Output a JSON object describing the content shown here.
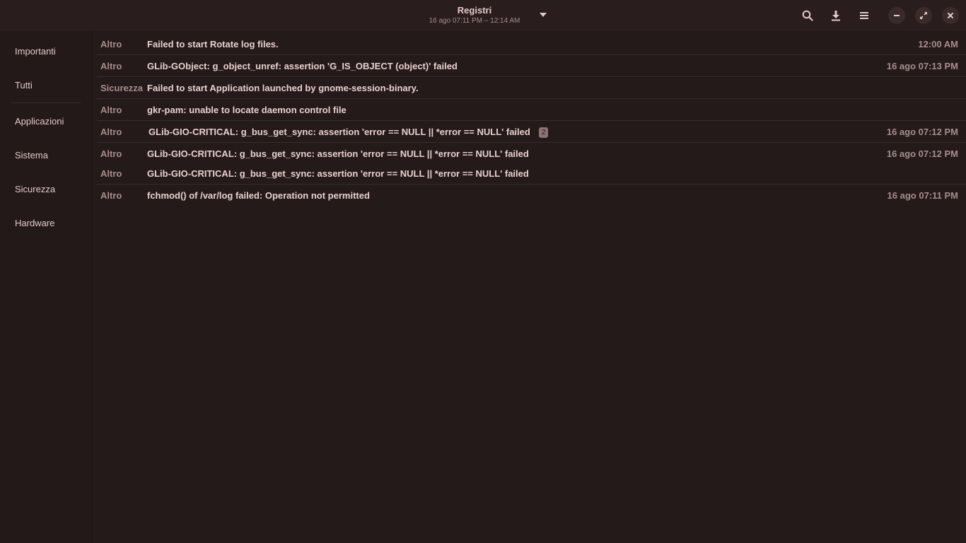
{
  "header": {
    "title": "Registri",
    "subtitle": "16 ago 07:11 PM – 12:14 AM",
    "icons": {
      "search": "search-icon",
      "export": "download-icon",
      "menu": "hamburger-menu-icon",
      "minimize": "minimize-icon",
      "restore": "restore-icon",
      "close": "close-icon"
    }
  },
  "sidebar": {
    "items": [
      {
        "label": "Importanti"
      },
      {
        "label": "Tutti"
      },
      {
        "label": "Applicazioni"
      },
      {
        "label": "Sistema"
      },
      {
        "label": "Sicurezza"
      },
      {
        "label": "Hardware"
      }
    ]
  },
  "events": [
    {
      "category": "Altro",
      "message": "Failed to start Rotate log files.",
      "time": "12:00 AM",
      "count": ""
    },
    {
      "category": "Altro",
      "message": "GLib-GObject: g_object_unref: assertion 'G_IS_OBJECT (object)' failed",
      "time": "16 ago 07:13 PM",
      "count": ""
    },
    {
      "category": "Sicurezza",
      "message": "Failed to start Application launched by gnome-session-binary.",
      "time": "",
      "count": ""
    },
    {
      "category": "Altro",
      "message": "gkr-pam: unable to locate daemon control file",
      "time": "",
      "count": ""
    },
    {
      "category": "Altro",
      "message": "GLib-GIO-CRITICAL: g_bus_get_sync: assertion 'error == NULL || *error == NULL' failed",
      "time": "16 ago 07:12 PM",
      "count": "2"
    },
    {
      "category": "Altro",
      "message": "GLib-GIO-CRITICAL: g_bus_get_sync: assertion 'error == NULL || *error == NULL' failed",
      "time": "16 ago 07:12 PM",
      "count": ""
    },
    {
      "category": "Altro",
      "message": "GLib-GIO-CRITICAL: g_bus_get_sync: assertion 'error == NULL || *error == NULL' failed",
      "time": "",
      "count": ""
    },
    {
      "category": "Altro",
      "message": "fchmod() of /var/log failed: Operation not permitted",
      "time": "16 ago 07:11 PM",
      "count": ""
    }
  ],
  "colors": {
    "background": "#231919",
    "text": "#e6c8c8",
    "dim_text": "#a98c8c"
  }
}
